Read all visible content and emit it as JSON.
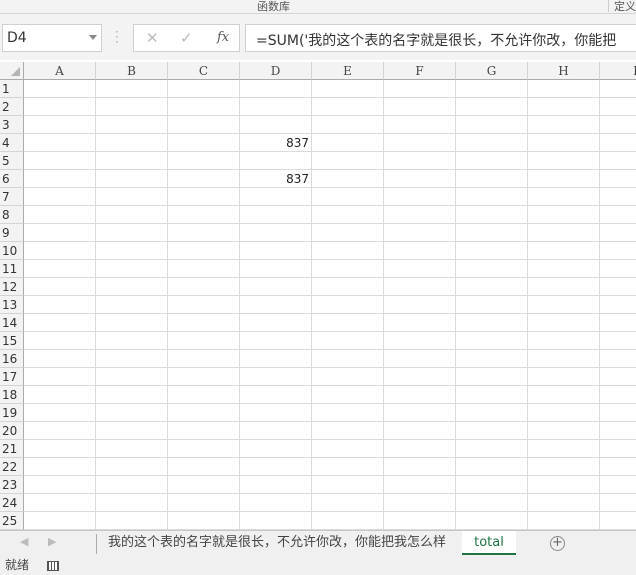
{
  "ribbon": {
    "group_label": "函数库",
    "group_label_right": "定义"
  },
  "formula_bar": {
    "name_box": "D4",
    "cancel_icon": "✕",
    "enter_icon": "✓",
    "fx_label": "fx",
    "formula": "=SUM('我的这个表的名字就是很长，不允许你改，你能把"
  },
  "columns": [
    "A",
    "B",
    "C",
    "D",
    "E",
    "F",
    "G",
    "H",
    "I"
  ],
  "rows": [
    "1",
    "2",
    "3",
    "4",
    "5",
    "6",
    "7",
    "8",
    "9",
    "10",
    "11",
    "12",
    "13",
    "14",
    "15",
    "16",
    "17",
    "18",
    "19",
    "20",
    "21",
    "22",
    "23",
    "24",
    "25"
  ],
  "cells": {
    "D4": "837",
    "D6": "837"
  },
  "sheet_tabs": {
    "prev": "◀",
    "next": "▶",
    "tabs": [
      {
        "label": "我的这个表的名字就是很长，不允许你改，你能把我怎么样",
        "active": false
      },
      {
        "label": "total",
        "active": true
      }
    ],
    "add": "+"
  },
  "status_bar": {
    "status": "就绪"
  }
}
